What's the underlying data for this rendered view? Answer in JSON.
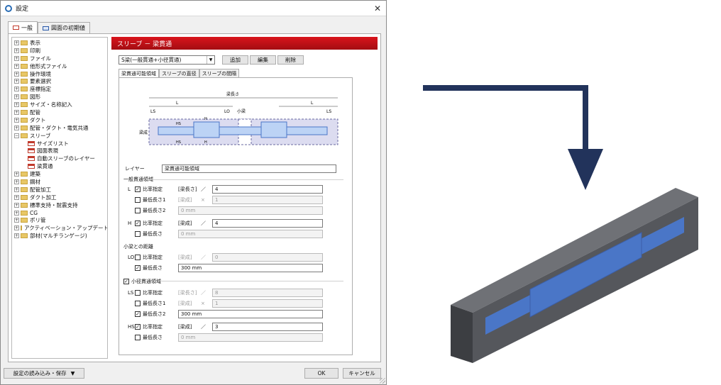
{
  "window": {
    "title": "設定",
    "close": "✕"
  },
  "outer_tabs": [
    {
      "label": "一般"
    },
    {
      "label": "図面の初期値"
    }
  ],
  "tree": {
    "items": [
      {
        "label": "表示"
      },
      {
        "label": "印刷"
      },
      {
        "label": "ファイル"
      },
      {
        "label": "他形式ファイル"
      },
      {
        "label": "操作環境"
      },
      {
        "label": "要素選択"
      },
      {
        "label": "座標指定"
      },
      {
        "label": "図形"
      },
      {
        "label": "サイズ・名称記入"
      },
      {
        "label": "配管"
      },
      {
        "label": "ダクト"
      },
      {
        "label": "配管・ダクト・電気共通"
      },
      {
        "label": "スリーブ"
      }
    ],
    "children": [
      {
        "label": "サイズリスト"
      },
      {
        "label": "図面表現"
      },
      {
        "label": "自動スリーブのレイヤー"
      },
      {
        "label": "梁貫通"
      }
    ],
    "items2": [
      {
        "label": "建築"
      },
      {
        "label": "鋼材"
      },
      {
        "label": "配管加工"
      },
      {
        "label": "ダクト加工"
      },
      {
        "label": "標準支持・耐震支持"
      },
      {
        "label": "CG"
      },
      {
        "label": "ポリ管"
      },
      {
        "label": "アクティベーション・アップデート"
      },
      {
        "label": "部材(マルチランゲージ)"
      }
    ]
  },
  "panel": {
    "header": "スリーブ － 梁貫通",
    "type_select": "S梁(一般貫通+小径貫通)",
    "buttons": {
      "add": "追加",
      "edit": "編集",
      "delete": "削除"
    },
    "inner_tabs": [
      {
        "label": "梁貫通可能領域"
      },
      {
        "label": "スリーブの直径"
      },
      {
        "label": "スリーブの間隔"
      }
    ],
    "diagram": {
      "beam_length": "梁長さ",
      "L": "L",
      "LS": "LS",
      "LO": "LO",
      "small_beam": "小梁",
      "beam_depth": "梁成",
      "HS": "HS",
      "H": "H"
    },
    "layer_label": "レイヤー",
    "layer_value": "梁貫通可能領域",
    "general": {
      "title": "一般貫通領域",
      "L_label": "L",
      "H_label": "H",
      "ratio": "比率指定",
      "min1": "最低長さ1",
      "min2": "最低長さ2",
      "min": "最低長さ",
      "L_ratio_basis": "[梁長さ]",
      "L_ratio_op": "／",
      "L_ratio_val": "4",
      "L_min1_basis": "[梁成]",
      "L_min1_op": "×",
      "L_min1_val": "1",
      "L_min2_val": "0 mm",
      "H_ratio_basis": "[梁成]",
      "H_ratio_op": "／",
      "H_ratio_val": "4",
      "H_min_val": "0 mm"
    },
    "small_beam_dist": {
      "title": "小梁との距離",
      "LO_label": "LO",
      "ratio": "比率指定",
      "min": "最低長さ",
      "basis": "[梁成]",
      "op": "／",
      "val": "0",
      "min_val": "300 mm"
    },
    "small": {
      "title": "小径貫通領域",
      "LS_label": "LS",
      "HS_label": "HS",
      "ratio": "比率指定",
      "min1": "最低長さ1",
      "min2": "最低長さ2",
      "min": "最低長さ",
      "LS_ratio_basis": "[梁長さ]",
      "LS_ratio_op": "／",
      "LS_ratio_val": "8",
      "LS_min1_basis": "[梁成]",
      "LS_min1_op": "×",
      "LS_min1_val": "1",
      "LS_min2_val": "300 mm",
      "HS_ratio_basis": "[梁成]",
      "HS_ratio_op": "／",
      "HS_ratio_val": "3",
      "HS_min_val": "0 mm"
    }
  },
  "bottom": {
    "load_save": "設定の読み込み・保存",
    "ok": "OK",
    "cancel": "キャンセル"
  },
  "colors": {
    "header_red": "#c8101a",
    "arrow_navy": "#22335b",
    "beam_gray": "#4d4f54",
    "opening_blue": "#4a76c7"
  }
}
